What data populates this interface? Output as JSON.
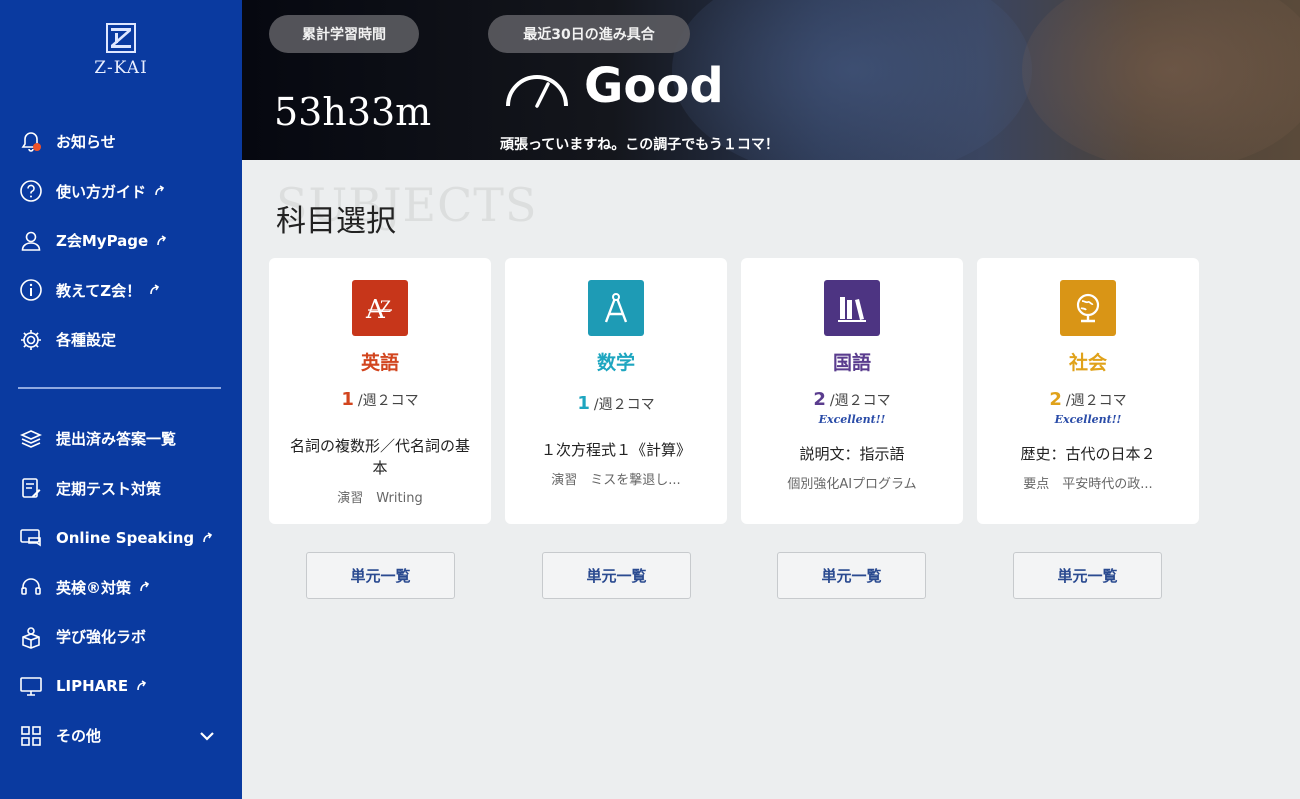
{
  "brand": {
    "name": "Z-KAI"
  },
  "sidebar": {
    "primary": [
      {
        "label": "お知らせ",
        "icon": "bell-icon",
        "external": false
      },
      {
        "label": "使い方ガイド",
        "icon": "help-circle-icon",
        "external": true
      },
      {
        "label": "Z会MyPage",
        "icon": "user-icon",
        "external": true
      },
      {
        "label": "教えてZ会！",
        "icon": "info-circle-icon",
        "external": true
      },
      {
        "label": "各種設定",
        "icon": "gear-icon",
        "external": false
      }
    ],
    "secondary": [
      {
        "label": "提出済み答案一覧",
        "icon": "layers-icon",
        "external": false
      },
      {
        "label": "定期テスト対策",
        "icon": "document-edit-icon",
        "external": false
      },
      {
        "label": "Online Speaking",
        "icon": "chat-screen-icon",
        "external": true
      },
      {
        "label": "英検®対策",
        "icon": "headset-icon",
        "external": true
      },
      {
        "label": "学び強化ラボ",
        "icon": "cube-person-icon",
        "external": false
      },
      {
        "label": "LIPHARE",
        "icon": "monitor-icon",
        "external": true
      },
      {
        "label": "その他",
        "icon": "grid-icon",
        "external": false
      }
    ]
  },
  "header": {
    "total_label": "累計学習時間",
    "total_value": "53h33m",
    "progress_label": "最近30日の進み具合",
    "progress_value": "Good",
    "cheer": "頑張っていますね。この調子でもう１コマ！"
  },
  "main": {
    "ghost_title": "SUBJECTS",
    "title": "科目選択",
    "unit_button_label": "単元一覧",
    "subjects": [
      {
        "name": "英語",
        "color": "#d2451e",
        "count": "1",
        "per_week": "/週２コマ",
        "badge": "",
        "lesson": "名詞の複数形／代名詞の基本",
        "sub": "演習　Writing"
      },
      {
        "name": "数学",
        "color": "#1ea6c0",
        "count": "1",
        "per_week": "/週２コマ",
        "badge": "",
        "lesson": "１次方程式１《計算》",
        "sub": "演習　ミスを撃退し..."
      },
      {
        "name": "国語",
        "color": "#5a3c8e",
        "count": "2",
        "per_week": "/週２コマ",
        "badge": "Excellent!!",
        "lesson": "説明文：指示語",
        "sub": "個別強化AIプログラム"
      },
      {
        "name": "社会",
        "color": "#e0a21a",
        "count": "2",
        "per_week": "/週２コマ",
        "badge": "Excellent!!",
        "lesson": "歴史：古代の日本２",
        "sub": "要点　平安時代の政..."
      }
    ]
  }
}
